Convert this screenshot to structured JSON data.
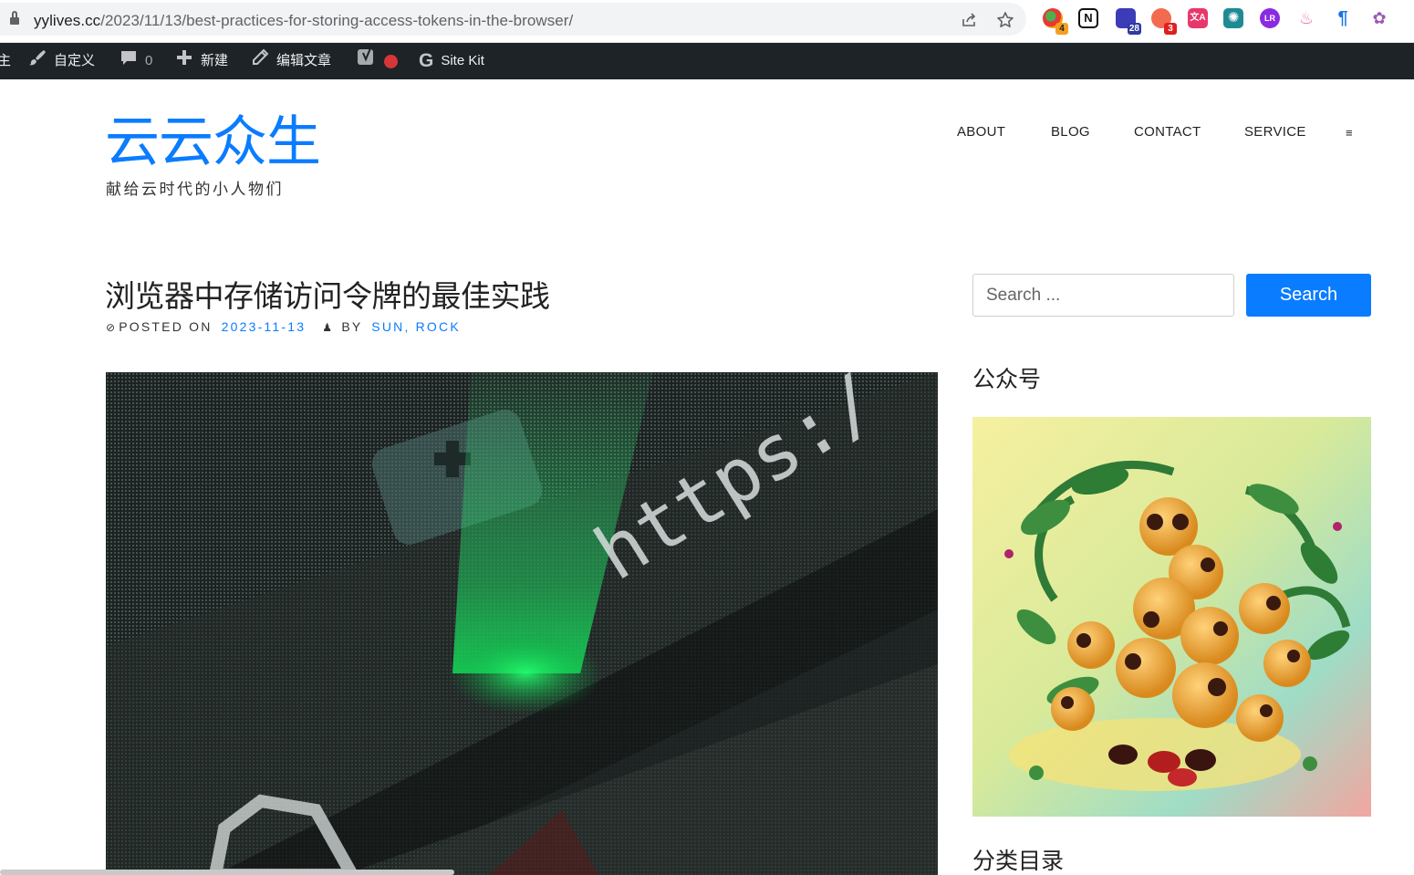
{
  "browser": {
    "url_host": "yylives.cc",
    "url_path": "/2023/11/13/best-practices-for-storing-access-tokens-in-the-browser/",
    "extension_badges": {
      "ext1": "4",
      "ext3": "28",
      "ext4": "3"
    },
    "extension_labels": {
      "notion": "N",
      "translate": "文A",
      "lr": "LR"
    }
  },
  "admin_bar": {
    "cut_item": "主",
    "customize": "自定义",
    "comments_count": "0",
    "new": "新建",
    "edit_post": "编辑文章",
    "site_kit": "Site Kit"
  },
  "site": {
    "title": "云云众生",
    "tagline": "献给云时代的小人物们"
  },
  "nav": {
    "items": [
      "ABOUT",
      "BLOG",
      "CONTACT",
      "SERVICE"
    ],
    "menu_glyph": "≡"
  },
  "post": {
    "title": "浏览器中存储访问令牌的最佳实践",
    "posted_on_label": "POSTED ON",
    "date": "2023-11-13",
    "by_label": "BY",
    "authors": "SUN, ROCK",
    "hero_text": "https:/"
  },
  "sidebar": {
    "search_placeholder": "Search ...",
    "search_button": "Search",
    "widget1_title": "公众号",
    "widget2_title": "分类目录"
  },
  "colors": {
    "accent": "#0a7cff",
    "admin_bar_bg": "#1d2327",
    "admin_dot": "#d63638"
  }
}
